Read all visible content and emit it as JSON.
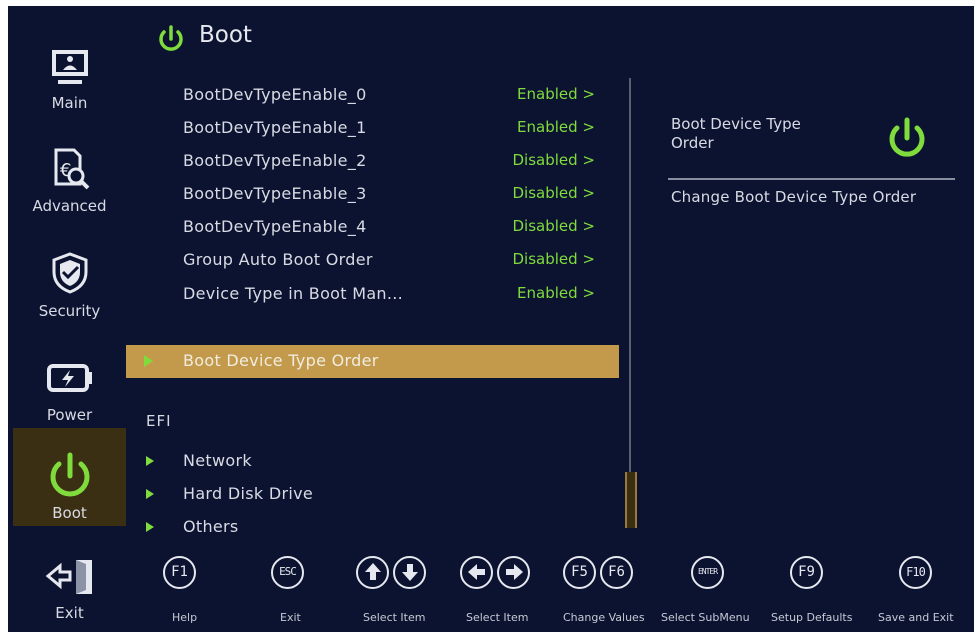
{
  "page": {
    "title": "Boot"
  },
  "sidebar": {
    "items": [
      {
        "label": "Main",
        "icon": "monitor-icon"
      },
      {
        "label": "Advanced",
        "icon": "advanced-settings-icon"
      },
      {
        "label": "Security",
        "icon": "shield-icon"
      },
      {
        "label": "Power",
        "icon": "battery-icon"
      },
      {
        "label": "Boot",
        "icon": "power-icon",
        "active": true
      },
      {
        "label": "Exit",
        "icon": "exit-door-icon"
      }
    ]
  },
  "options": [
    {
      "name": "BootDevTypeEnable_0",
      "value": "Enabled >"
    },
    {
      "name": "BootDevTypeEnable_1",
      "value": "Enabled >"
    },
    {
      "name": "BootDevTypeEnable_2",
      "value": "Disabled >"
    },
    {
      "name": "BootDevTypeEnable_3",
      "value": "Disabled >"
    },
    {
      "name": "BootDevTypeEnable_4",
      "value": "Disabled >"
    },
    {
      "name": "Group Auto Boot Order",
      "value": "Disabled >"
    },
    {
      "name": "Device Type in Boot Man...",
      "value": "Enabled >"
    }
  ],
  "selected": {
    "label": "Boot Device Type Order"
  },
  "efi": {
    "heading": "EFI",
    "items": [
      "Network",
      "Hard Disk Drive",
      "Others"
    ]
  },
  "help": {
    "title": "Boot Device Type Order",
    "description": "Change Boot Device Type Order",
    "icon": "power-icon"
  },
  "footer": {
    "keys": [
      {
        "key": "F1",
        "label": "Help"
      },
      {
        "key": "ESC",
        "label": "Exit"
      },
      {
        "key": "up-down",
        "label": "Select Item"
      },
      {
        "key": "left-right",
        "label": "Select Item"
      },
      {
        "key": "F5 F6",
        "label": "Change Values"
      },
      {
        "key": "ENTER",
        "label": "Select SubMenu"
      },
      {
        "key": "F9",
        "label": "Setup Defaults"
      },
      {
        "key": "F10",
        "label": "Save and Exit"
      }
    ]
  },
  "colors": {
    "background": "#0c1330",
    "accent": "#7fdc3c",
    "highlight": "#c39a4c",
    "active_tab": "#3a2e13"
  }
}
